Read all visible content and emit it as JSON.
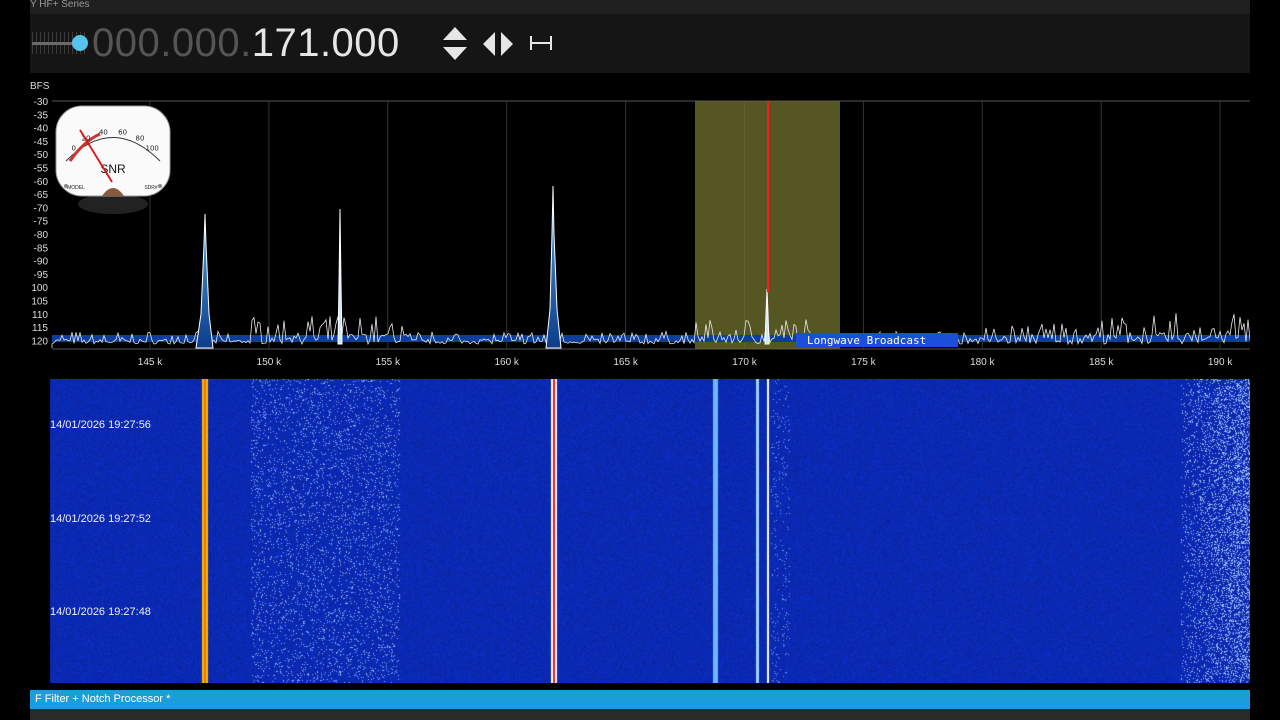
{
  "window": {
    "title": "Y HF+ Series"
  },
  "frequency": {
    "dim_digits": "000.000.",
    "bright_digits": "171.000"
  },
  "spectrum": {
    "unit_label": "BFS",
    "db_labels": [
      "-30",
      "-35",
      "-40",
      "-45",
      "-50",
      "-55",
      "-60",
      "-65",
      "-70",
      "-75",
      "-80",
      "-85",
      "-90",
      "-95",
      "100",
      "105",
      "110",
      "115",
      "120"
    ],
    "freq_labels": [
      "145 k",
      "150 k",
      "155 k",
      "160 k",
      "165 k",
      "170 k",
      "175 k",
      "180 k",
      "185 k",
      "190 k"
    ],
    "band_label": "Longwave Broadcast"
  },
  "snr_meter": {
    "label": "SNR",
    "scale": [
      "0",
      "20",
      "40",
      "60",
      "80",
      "100"
    ],
    "left_caption": "MODEL",
    "right_caption": "SDR#"
  },
  "waterfall": {
    "timestamps": [
      "14/01/2026 19:27:56",
      "14/01/2026 19:27:52",
      "14/01/2026 19:27:48"
    ]
  },
  "status": {
    "text": "F Filter + Notch Processor *"
  },
  "colors": {
    "accent": "#1c9ddb",
    "filter_band": "#6b6b2c",
    "tuning_line": "#ff1a1a",
    "waterfall_base": "#0a1a8c"
  },
  "icons": [
    "up-down-arrows-icon",
    "left-right-arrows-icon",
    "span-icon"
  ]
}
